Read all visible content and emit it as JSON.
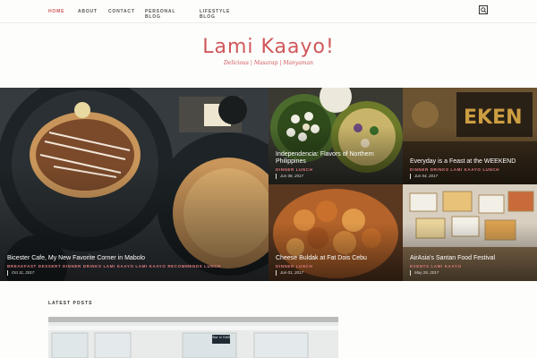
{
  "nav": {
    "items": [
      {
        "label": "HOME",
        "active": true
      },
      {
        "label": "ABOUT"
      },
      {
        "label": "CONTACT"
      },
      {
        "label": "PERSONAL BLOG"
      },
      {
        "label": "LIFESTYLE BLOG"
      }
    ],
    "search_icon": "search-icon"
  },
  "site": {
    "title": "Lami Kaayo!",
    "tagline": "Delicious | Masarap | Manyaman"
  },
  "posts": [
    {
      "title": "Bicester Cafe, My New Favorite Corner in Mabolo",
      "categories": "BREAKFAST DESSERT DINNER DRINKS LAMI KAAYO LAMI KAAYO RECOMMENDS LUNCH",
      "date": "Oct 11, 2017"
    },
    {
      "title": "Independencia: Flavors of Northern Philippines",
      "categories": "DINNER LUNCH",
      "date": "Jun 08, 2017"
    },
    {
      "title": "Everyday is a Feast at the WEEKEND",
      "categories": "DINNER DRINKS LAMI KAAYO LUNCH",
      "date": "Jun 04, 2017"
    },
    {
      "title": "Cheese Buldak at Fat Dois Cebu",
      "categories": "DINNER LUNCH",
      "date": "Jun 01, 2017"
    },
    {
      "title": "AirAsia's Santan Food Festival",
      "categories": "EVENTS LAMI KAAYO",
      "date": "May 28, 2017"
    }
  ],
  "latest": {
    "heading": "LATEST POSTS",
    "sign_text": "Bar & Grill"
  },
  "colors": {
    "accent": "#d0575b",
    "background": "#fdfdfb"
  }
}
